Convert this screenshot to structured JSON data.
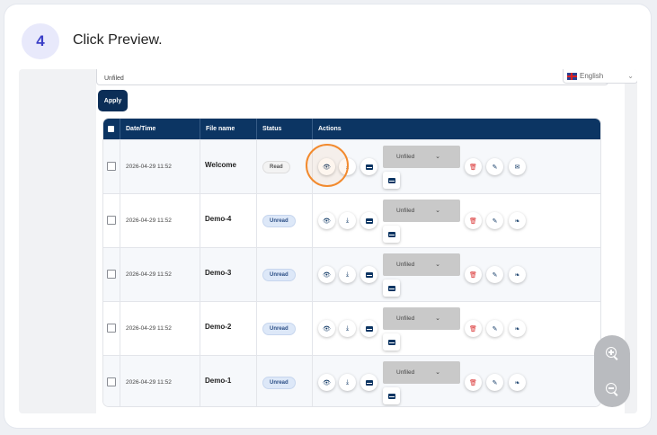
{
  "step": {
    "number": "4",
    "instruction": "Click Preview."
  },
  "filter": {
    "value": "Unfiled",
    "apply_label": "Apply"
  },
  "language": {
    "label": "English"
  },
  "table": {
    "headers": [
      "Date/Time",
      "File name",
      "Status",
      "Actions"
    ],
    "rows": [
      {
        "datetime": "2026-04-29 11:52",
        "file": "Welcome",
        "status": "Read",
        "folder": "Unfiled"
      },
      {
        "datetime": "2026-04-29 11:52",
        "file": "Demo-4",
        "status": "Unread",
        "folder": "Unfiled"
      },
      {
        "datetime": "2026-04-29 11:52",
        "file": "Demo-3",
        "status": "Unread",
        "folder": "Unfiled"
      },
      {
        "datetime": "2026-04-29 11:52",
        "file": "Demo-2",
        "status": "Unread",
        "folder": "Unfiled"
      },
      {
        "datetime": "2026-04-29 11:52",
        "file": "Demo-1",
        "status": "Unread",
        "folder": "Unfiled"
      }
    ]
  },
  "colors": {
    "header": "#0c3563",
    "highlight": "#f28a2e",
    "delete": "#d93030"
  },
  "icons": [
    "eye-icon",
    "download-icon",
    "mail-icon",
    "chevron-down-icon",
    "trash-icon",
    "pencil-icon",
    "envelope-open-icon",
    "leaf-icon",
    "zoom-in-icon",
    "zoom-out-icon"
  ]
}
